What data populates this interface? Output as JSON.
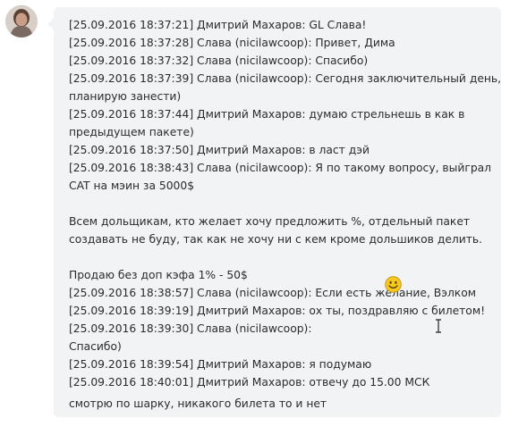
{
  "chat": {
    "lines": [
      "[25.09.2016 18:37:21] Дмитрий Махаров: GL Слава!",
      "[25.09.2016 18:37:28] Слава (nicilawcoop): Привет, Дима",
      "[25.09.2016 18:37:32] Слава (nicilawcoop): Спасибо)",
      "[25.09.2016 18:37:39] Слава (nicilawcoop): Сегодня заключительный день,",
      "планирую занести)",
      "[25.09.2016 18:37:44] Дмитрий Махаров: думаю стрельнешь в как в",
      "предыдущем пакете)",
      "[25.09.2016 18:37:50] Дмитрий Махаров: в ласт дэй",
      "[25.09.2016 18:38:43] Слава (nicilawcoop): Я по такому вопросу, выйграл",
      "CAT на мэин за 5000$",
      "",
      "Всем дольщикам, кто желает хочу предложить %, отдельный пакет",
      "создавать не буду, так как не хочу ни с кем кроме дольшиков делить.",
      "",
      "Продаю без доп кэфа 1% - 50$",
      "[25.09.2016 18:38:57] Слава (nicilawcoop): Если есть желание, Вэлком",
      "[25.09.2016 18:39:19] Дмитрий Махаров: ох ты, поздравляю с билетом!",
      "[25.09.2016 18:39:30] Слава (nicilawcoop):",
      "Спасибо)",
      "[25.09.2016 18:39:54] Дмитрий Махаров: я подумаю",
      "[25.09.2016 18:40:01] Дмитрий Махаров: отвечу до 15.00 МСК",
      "смотрю по шарку, никакого билета то и нет"
    ]
  },
  "icons": {
    "avatar": "user-avatar",
    "emoticon": "smiley-icon",
    "cursor": "text-cursor-icon"
  },
  "colors": {
    "bubble": "#f1f3f5",
    "text": "#2b2b2b",
    "smiley": "#f7c81e"
  }
}
